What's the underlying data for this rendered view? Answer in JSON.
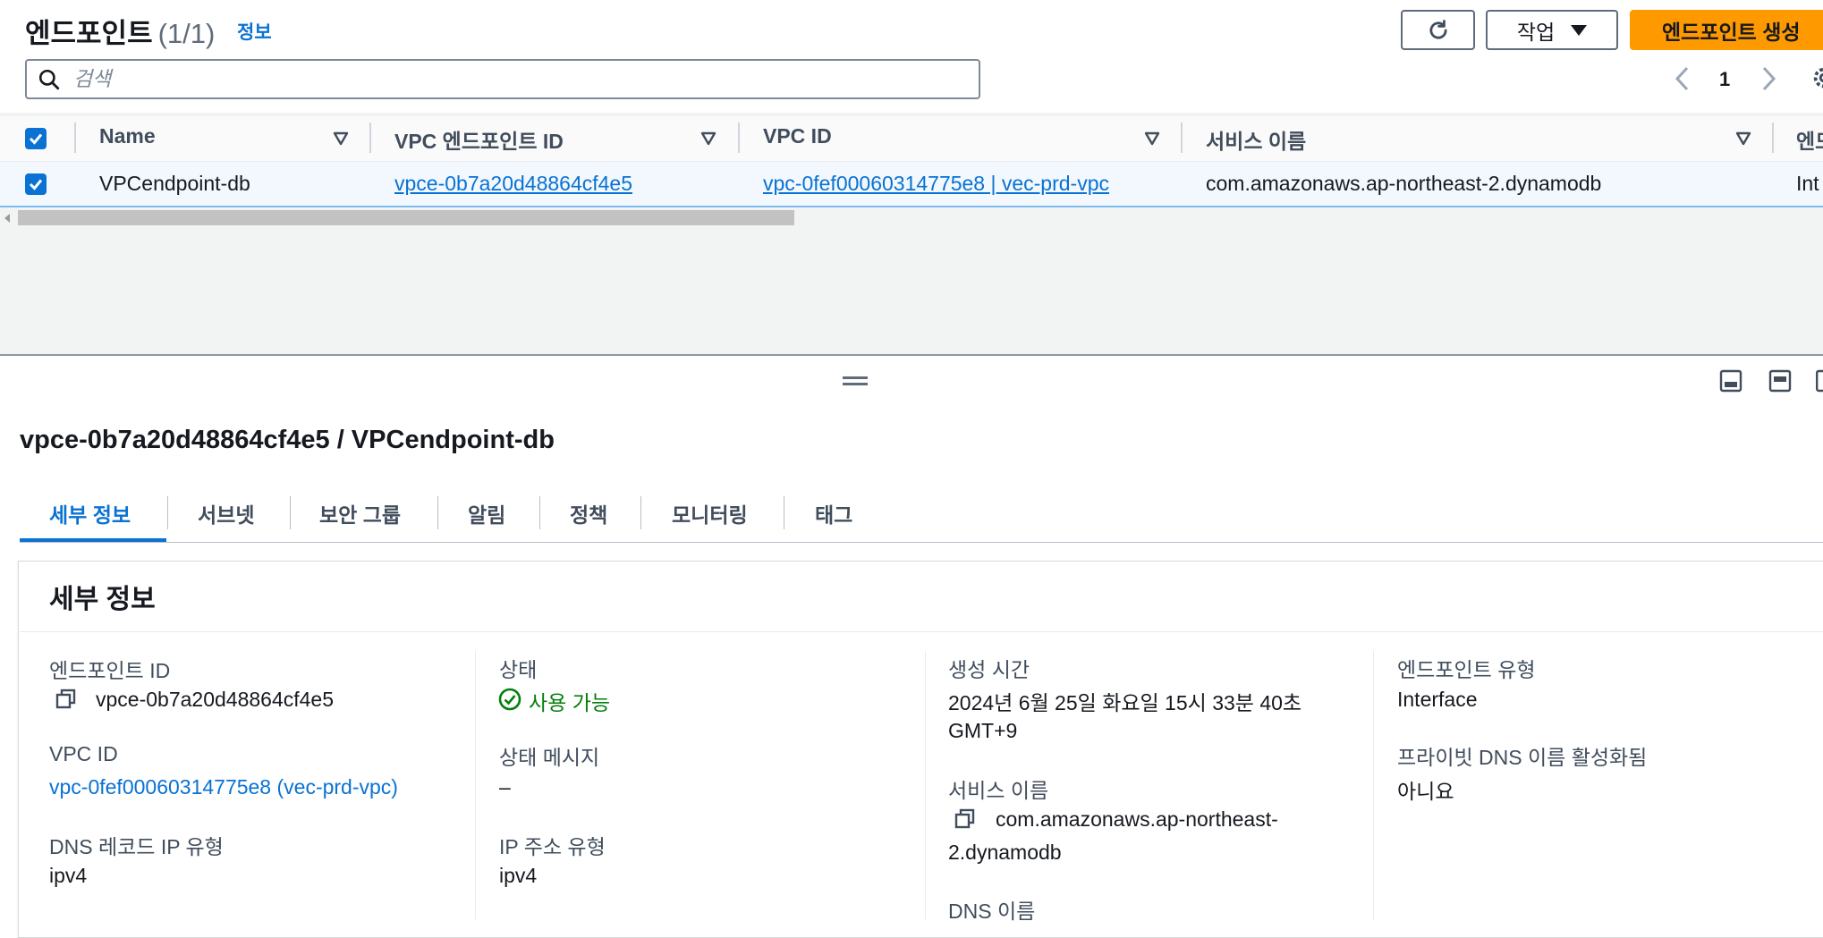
{
  "list": {
    "title": "엔드포인트",
    "count": "(1/1)",
    "info_link": "정보",
    "actions_label": "작업",
    "create_label": "엔드포인트 생성",
    "search_placeholder": "검색",
    "page_number": "1"
  },
  "table": {
    "columns": [
      "Name",
      "VPC 엔드포인트 ID",
      "VPC ID",
      "서비스 이름",
      "엔드"
    ],
    "rows": [
      {
        "name": "VPCendpoint-db",
        "endpoint_id": "vpce-0b7a20d48864cf4e5",
        "vpc_id": "vpc-0fef00060314775e8 | vec-prd-vpc",
        "service_name": "com.amazonaws.ap-northeast-2.dynamodb",
        "type": "Int"
      }
    ]
  },
  "detail": {
    "title": "vpce-0b7a20d48864cf4e5 / VPCendpoint-db",
    "tabs": [
      "세부 정보",
      "서브넷",
      "보안 그룹",
      "알림",
      "정책",
      "모니터링",
      "태그"
    ],
    "section_title": "세부 정보",
    "col1": {
      "endpoint_id_label": "엔드포인트 ID",
      "endpoint_id_value": "vpce-0b7a20d48864cf4e5",
      "vpc_id_label": "VPC ID",
      "vpc_id_value": "vpc-0fef00060314775e8 (vec-prd-vpc)",
      "dns_record_label": "DNS 레코드 IP 유형",
      "dns_record_value": "ipv4"
    },
    "col2": {
      "status_label": "상태",
      "status_value": "사용 가능",
      "status_message_label": "상태 메시지",
      "status_message_value": "–",
      "ip_type_label": "IP 주소 유형",
      "ip_type_value": "ipv4"
    },
    "col3": {
      "created_label": "생성 시간",
      "created_value_line1": "2024년 6월 25일 화요일 15시 33분 40초",
      "created_value_line2": "GMT+9",
      "service_label": "서비스 이름",
      "service_value_line1": "com.amazonaws.ap-northeast-",
      "service_value_line2": "2.dynamodb",
      "dns_name_label": "DNS 이름"
    },
    "col4": {
      "endpoint_type_label": "엔드포인트 유형",
      "endpoint_type_value": "Interface",
      "private_dns_label": "프라이빗 DNS 이름 활성화됨",
      "private_dns_value": "아니요"
    }
  },
  "colors": {
    "primary_button": "#ff9900",
    "link": "#0972d3",
    "success": "#037f0c",
    "selected_row": "#f2f8fd"
  }
}
